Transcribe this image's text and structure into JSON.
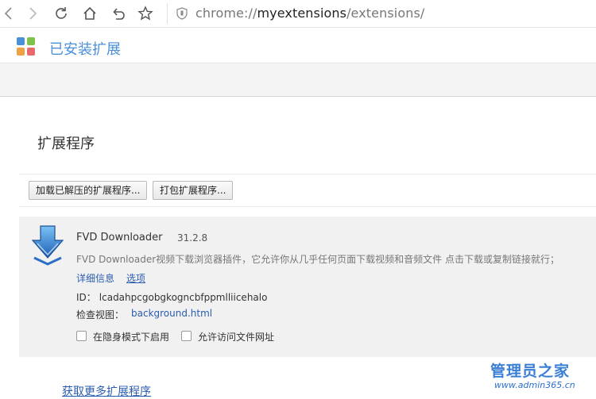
{
  "browser": {
    "url_prefix": "chrome://",
    "url_host": "myextensions",
    "url_path": "/extensions/"
  },
  "header": {
    "title": "已安装扩展"
  },
  "section": {
    "title": "扩展程序"
  },
  "actions": {
    "load_unpacked": "加载已解压的扩展程序...",
    "pack": "打包扩展程序..."
  },
  "extension": {
    "icon": "download-arrow-icon",
    "name": "FVD Downloader",
    "version": "31.2.8",
    "description": "FVD Downloader视频下载浏览器插件，它允许你从几乎任何页面下载视频和音频文件 点击下载或复制链接就行；",
    "details_link": "详细信息",
    "options_link": "选项",
    "id_label": "ID：",
    "id_value": "lcadahpcgobgkogncbfppmlliicehalo",
    "inspect_label": "检查视图：",
    "inspect_link": "background.html",
    "incognito_label": "在隐身模式下启用",
    "file_access_label": "允许访问文件网址"
  },
  "footer": {
    "more_link": "获取更多扩展程序"
  },
  "watermark": {
    "title": "管理员之家",
    "url": "www.admin365.cn"
  },
  "colors": {
    "accent": "#4a90d9",
    "link": "#2a5db0",
    "card_bg": "#f1f1f1"
  }
}
